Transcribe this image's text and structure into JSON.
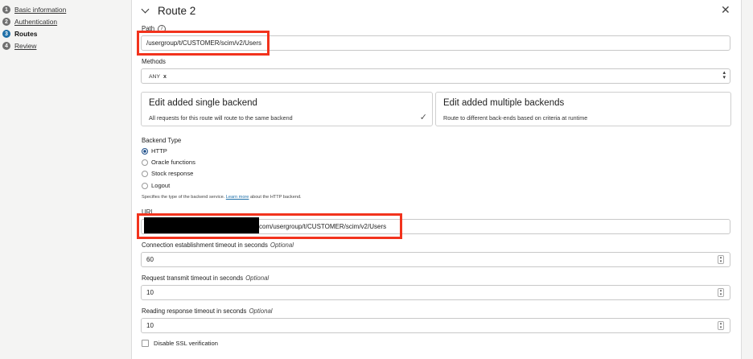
{
  "steps": [
    {
      "num": "1",
      "label": "Basic information"
    },
    {
      "num": "2",
      "label": "Authentication"
    },
    {
      "num": "3",
      "label": "Routes"
    },
    {
      "num": "4",
      "label": "Review"
    }
  ],
  "route": {
    "title": "Route 2",
    "close_icon": "close-icon"
  },
  "path": {
    "label": "Path",
    "info_icon": "i",
    "value": "/usergroup/t/CUSTOMER/scim/v2/Users"
  },
  "methods": {
    "label": "Methods",
    "chip": "ANY",
    "chip_remove": "x"
  },
  "backend_cards": [
    {
      "title": "Edit added single backend",
      "desc": "All requests for this route will route to the same backend",
      "selected": true
    },
    {
      "title": "Edit added multiple backends",
      "desc": "Route to different back-ends based on criteria at runtime",
      "selected": false
    }
  ],
  "backend_type": {
    "label": "Backend Type",
    "options": [
      "HTTP",
      "Oracle functions",
      "Stock response",
      "Logout"
    ],
    "selected": "HTTP",
    "helper_prefix": "Specifies the type of the backend service.",
    "helper_link": "Learn more",
    "helper_suffix": "about the HTTP backend."
  },
  "url": {
    "label": "URL",
    "value_visible": "com/usergroup/t/CUSTOMER/scim/v2/Users"
  },
  "timeouts": [
    {
      "label": "Connection establishment timeout in seconds",
      "optional": "Optional",
      "value": "60"
    },
    {
      "label": "Request transmit timeout in seconds",
      "optional": "Optional",
      "value": "10"
    },
    {
      "label": "Reading response timeout in seconds",
      "optional": "Optional",
      "value": "10"
    }
  ],
  "ssl": {
    "label": "Disable SSL verification",
    "checked": false
  },
  "colors": {
    "highlight": "#f2331d",
    "active_step": "#1e6fa8",
    "link": "#1e6fa8"
  }
}
